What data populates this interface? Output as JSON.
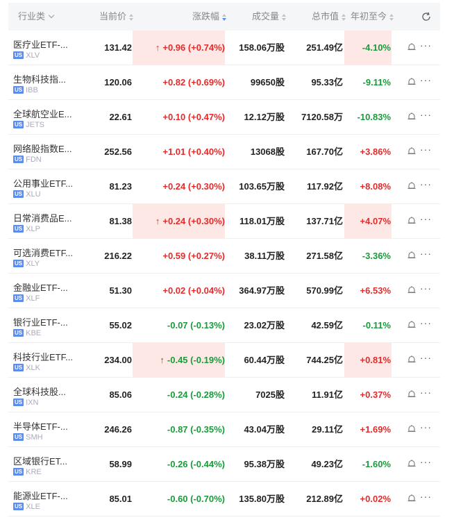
{
  "header": {
    "name": "行业类",
    "price": "当前价",
    "change": "涨跌幅",
    "volume": "成交量",
    "cap": "总市值",
    "ytd": "年初至今"
  },
  "colors": {
    "up": "#e32b2b",
    "down": "#1a9a3a",
    "highlight": "#fde8e6",
    "accent": "#5b8def"
  },
  "market_badge": "US",
  "rows": [
    {
      "name": "医疗业ETF-...",
      "ticker": "XLV",
      "price": "131.42",
      "change": "+0.96 (+0.74%)",
      "volume": "158.06万股",
      "cap": "251.49亿",
      "ytd": "-4.10%",
      "change_dir": "up",
      "ytd_dir": "down",
      "flash": true,
      "arrow": "↑"
    },
    {
      "name": "生物科技指...",
      "ticker": "IBB",
      "price": "120.06",
      "change": "+0.82 (+0.69%)",
      "volume": "99650股",
      "cap": "95.33亿",
      "ytd": "-9.11%",
      "change_dir": "up",
      "ytd_dir": "down",
      "flash": false,
      "arrow": ""
    },
    {
      "name": "全球航空业E...",
      "ticker": "JETS",
      "price": "22.61",
      "change": "+0.10 (+0.47%)",
      "volume": "12.12万股",
      "cap": "7120.58万",
      "ytd": "-10.83%",
      "change_dir": "up",
      "ytd_dir": "down",
      "flash": false,
      "arrow": ""
    },
    {
      "name": "网络股指数E...",
      "ticker": "FDN",
      "price": "252.56",
      "change": "+1.01 (+0.40%)",
      "volume": "13068股",
      "cap": "167.70亿",
      "ytd": "+3.86%",
      "change_dir": "up",
      "ytd_dir": "up",
      "flash": false,
      "arrow": ""
    },
    {
      "name": "公用事业ETF...",
      "ticker": "XLU",
      "price": "81.23",
      "change": "+0.24 (+0.30%)",
      "volume": "103.65万股",
      "cap": "117.92亿",
      "ytd": "+8.08%",
      "change_dir": "up",
      "ytd_dir": "up",
      "flash": false,
      "arrow": ""
    },
    {
      "name": "日常消费品E...",
      "ticker": "XLP",
      "price": "81.38",
      "change": "+0.24 (+0.30%)",
      "volume": "118.01万股",
      "cap": "137.71亿",
      "ytd": "+4.07%",
      "change_dir": "up",
      "ytd_dir": "up",
      "flash": true,
      "arrow": "↑"
    },
    {
      "name": "可选消费ETF...",
      "ticker": "XLY",
      "price": "216.22",
      "change": "+0.59 (+0.27%)",
      "volume": "38.11万股",
      "cap": "271.58亿",
      "ytd": "-3.36%",
      "change_dir": "up",
      "ytd_dir": "down",
      "flash": false,
      "arrow": ""
    },
    {
      "name": "金融业ETF-...",
      "ticker": "XLF",
      "price": "51.30",
      "change": "+0.02 (+0.04%)",
      "volume": "364.97万股",
      "cap": "570.99亿",
      "ytd": "+6.53%",
      "change_dir": "up",
      "ytd_dir": "up",
      "flash": false,
      "arrow": ""
    },
    {
      "name": "银行业ETF-...",
      "ticker": "KBE",
      "price": "55.02",
      "change": "-0.07 (-0.13%)",
      "volume": "23.02万股",
      "cap": "42.59亿",
      "ytd": "-0.11%",
      "change_dir": "down",
      "ytd_dir": "down",
      "flash": false,
      "arrow": ""
    },
    {
      "name": "科技行业ETF...",
      "ticker": "XLK",
      "price": "234.00",
      "change": "-0.45 (-0.19%)",
      "volume": "60.44万股",
      "cap": "744.25亿",
      "ytd": "+0.81%",
      "change_dir": "down",
      "ytd_dir": "up",
      "flash": true,
      "arrow": "↑"
    },
    {
      "name": "全球科技股...",
      "ticker": "IXN",
      "price": "85.06",
      "change": "-0.24 (-0.28%)",
      "volume": "7025股",
      "cap": "11.91亿",
      "ytd": "+0.37%",
      "change_dir": "down",
      "ytd_dir": "up",
      "flash": false,
      "arrow": ""
    },
    {
      "name": "半导体ETF-...",
      "ticker": "SMH",
      "price": "246.26",
      "change": "-0.87 (-0.35%)",
      "volume": "43.04万股",
      "cap": "29.11亿",
      "ytd": "+1.69%",
      "change_dir": "down",
      "ytd_dir": "up",
      "flash": false,
      "arrow": ""
    },
    {
      "name": "区域银行ET...",
      "ticker": "KRE",
      "price": "58.99",
      "change": "-0.26 (-0.44%)",
      "volume": "95.38万股",
      "cap": "49.23亿",
      "ytd": "-1.60%",
      "change_dir": "down",
      "ytd_dir": "down",
      "flash": false,
      "arrow": ""
    },
    {
      "name": "能源业ETF-...",
      "ticker": "XLE",
      "price": "85.01",
      "change": "-0.60 (-0.70%)",
      "volume": "135.80万股",
      "cap": "212.89亿",
      "ytd": "+0.02%",
      "change_dir": "down",
      "ytd_dir": "up",
      "flash": false,
      "arrow": ""
    }
  ]
}
